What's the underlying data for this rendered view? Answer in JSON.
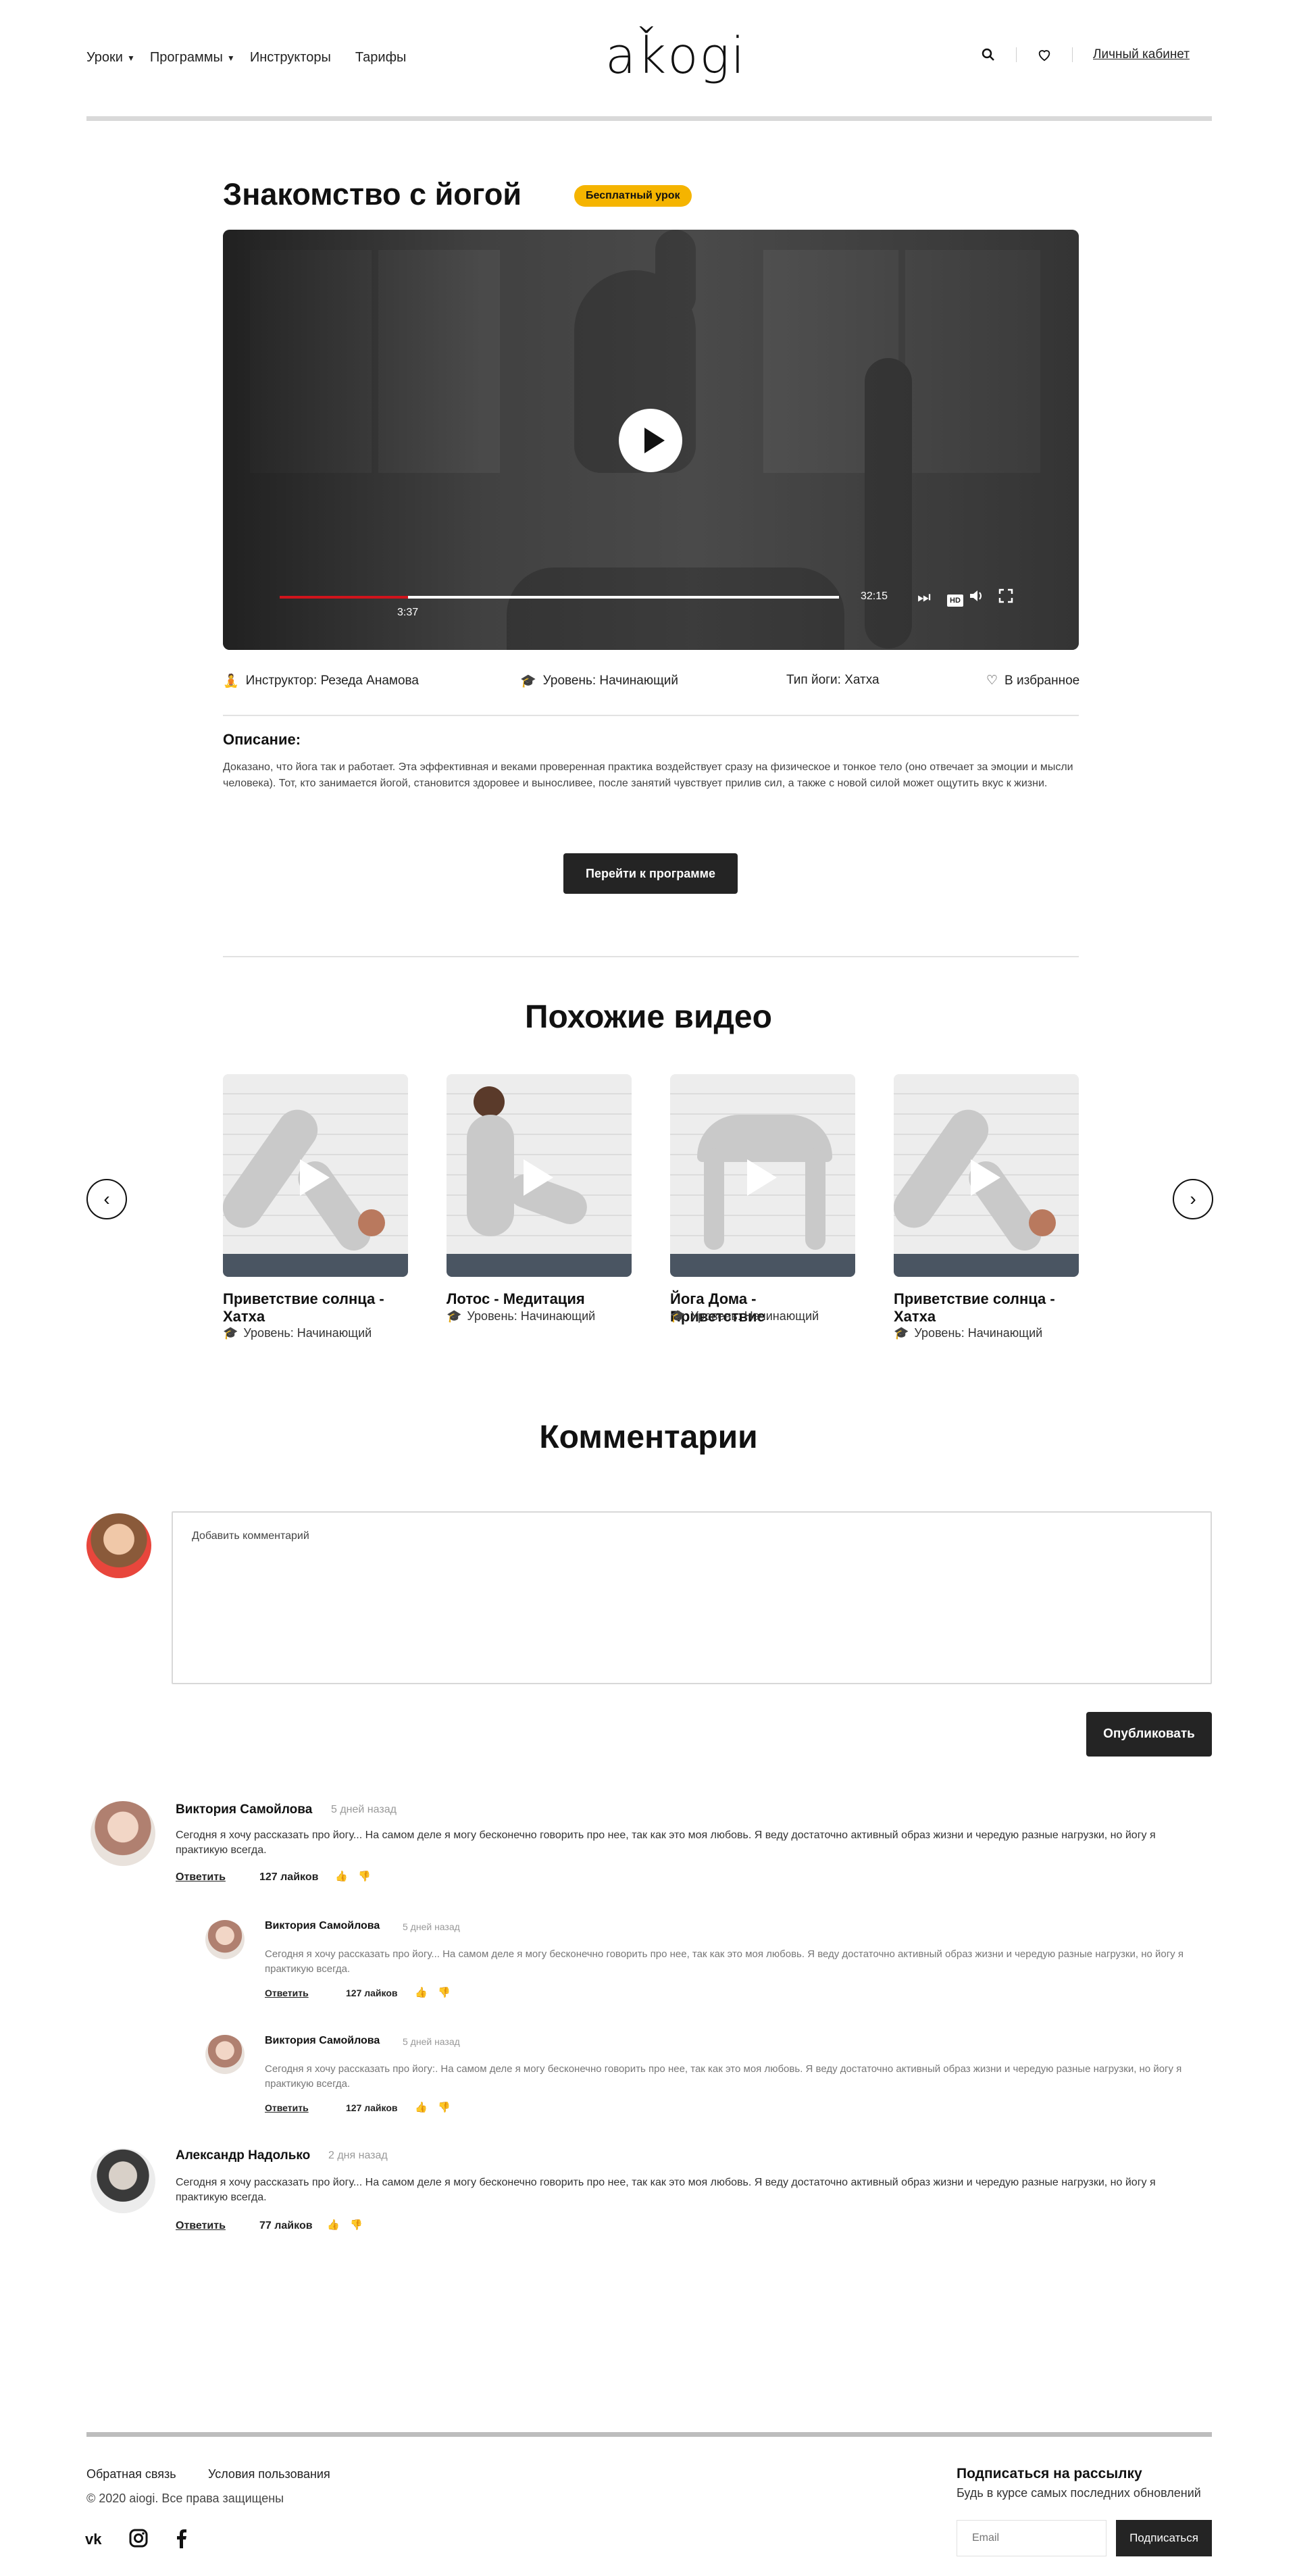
{
  "header": {
    "nav": [
      "Уроки",
      "Программы",
      "Инструкторы",
      "Тарифы"
    ],
    "logo": "aǩogi",
    "account_link": "Личный кабинет",
    "icons": [
      "search-icon",
      "heart-icon"
    ]
  },
  "lesson": {
    "title": "Знакомство с йогой",
    "badge": "Бесплатный урок",
    "video": {
      "current_time": "3:37",
      "duration": "32:15",
      "progress": 0.23,
      "hd_label": "HD"
    },
    "meta": {
      "instructor": "Инструктор: Резеда Анамова",
      "level": "Уровень: Начинающий",
      "type": "Тип йоги: Хатха",
      "favorite": "В избранное"
    },
    "description_title": "Описание:",
    "description_text": "Доказано, что йога так и работает. Эта эффективная и веками проверенная практика воздействует сразу на физическое и тонкое тело (оно отвечает за эмоции и мысли человека). Тот, кто занимается йогой, становится здоровее и выносливее, после занятий чувствует прилив сил, а также с новой силой может ощутить вкус к жизни.",
    "program_button": "Перейти к программе"
  },
  "similar": {
    "title": "Похожие видео",
    "cards": [
      {
        "title": "Приветствие солнца - Хатха",
        "level": "Уровень: Начинающий"
      },
      {
        "title": "Лотос - Медитация",
        "level": "Уровень: Начинающий"
      },
      {
        "title": "Йога Дома - Приветствие",
        "level": "Уровень: Начинающий"
      },
      {
        "title": "Приветствие солнца - Хатха",
        "level": "Уровень: Начинающий"
      }
    ]
  },
  "comments": {
    "title": "Комментарии",
    "placeholder": "Добавить комментарий",
    "publish_button": "Опубликовать",
    "items": [
      {
        "name": "Виктория Самойлова",
        "time": "5 дней назад",
        "text": "Сегодня я хочу рассказать про йогу... На самом деле я могу бесконечно говорить про нее, так как это моя любовь. Я веду достаточно активный образ жизни и чередую разные нагрузки, но йогу я практикую всегда.",
        "reply": "Ответить",
        "likes": "127 лайков"
      },
      {
        "name": "Виктория Самойлова",
        "time": "5 дней назад",
        "text": "Сегодня я хочу рассказать про йогу... На самом деле я могу бесконечно говорить про нее, так как это моя любовь. Я веду достаточно активный образ жизни и чередую разные нагрузки, но йогу я практикую всегда.",
        "reply": "Ответить",
        "likes": "127 лайков"
      },
      {
        "name": "Виктория Самойлова",
        "time": "5 дней назад",
        "text": "Сегодня я хочу рассказать про йогу:. На самом деле я могу бесконечно говорить про нее, так как это моя любовь. Я веду достаточно активный образ жизни и чередую разные нагрузки, но йогу я практикую всегда.",
        "reply": "Ответить",
        "likes": "127 лайков"
      },
      {
        "name": "Александр Надолько",
        "time": "2 дня назад",
        "text": "Сегодня я хочу рассказать про йогу... На самом деле я могу бесконечно говорить про нее, так как это моя любовь. Я веду достаточно активный образ жизни и чередую разные нагрузки, но йогу я практикую всегда.",
        "reply": "Ответить",
        "likes": "77 лайков"
      }
    ]
  },
  "footer": {
    "links": [
      "Обратная связь",
      "Условия пользования"
    ],
    "copyright": "© 2020 aiogi. Все права защищены",
    "social": [
      "vk-icon",
      "instagram-icon",
      "facebook-icon"
    ],
    "newsletter_title": "Подписаться на рассылку",
    "newsletter_text": "Будь в курсе самых последних обновлений",
    "email_placeholder": "Email",
    "subscribe_button": "Подписаться"
  },
  "colors": {
    "accent_badge": "#f5b400",
    "progress": "#d0141c",
    "dark_button": "#242424"
  }
}
